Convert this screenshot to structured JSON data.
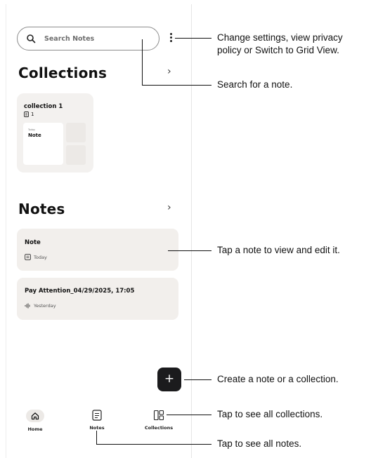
{
  "search": {
    "placeholder": "Search Notes"
  },
  "sections": {
    "collections_title": "Collections",
    "notes_title": "Notes",
    "chevron": "›"
  },
  "collection": {
    "name": "collection 1",
    "count": "1",
    "preview_day": "Today",
    "preview_title": "Note"
  },
  "notes": [
    {
      "title": "Note",
      "meta": "Today",
      "meta_icon": "document-icon"
    },
    {
      "title": "Pay Attention_04/29/2025, 17:05",
      "meta": "Yesterday",
      "meta_icon": "audio-wave-icon"
    }
  ],
  "fab": {
    "label": "+"
  },
  "tabs": [
    {
      "label": "Home",
      "icon": "home-icon"
    },
    {
      "label": "Notes",
      "icon": "notes-icon"
    },
    {
      "label": "Collections",
      "icon": "collections-icon"
    }
  ],
  "annotations": {
    "settings_line1": "Change settings, view privacy",
    "settings_line2": "policy or Switch to Grid View.",
    "search": "Search for a note.",
    "tap_note": "Tap a note to view and edit it.",
    "create": "Create a note or a collection.",
    "collections": "Tap to see all collections.",
    "all_notes": "Tap to see all notes."
  }
}
